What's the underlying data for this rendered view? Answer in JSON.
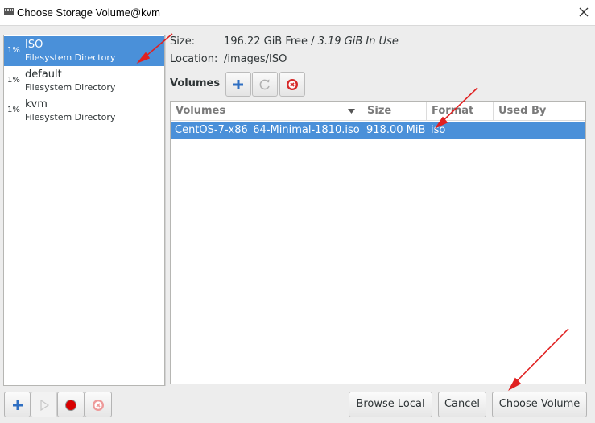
{
  "window": {
    "title": "Choose Storage Volume@kvm"
  },
  "pools": [
    {
      "pct": "1%",
      "name": "ISO",
      "type": "Filesystem Directory",
      "selected": true
    },
    {
      "pct": "1%",
      "name": "default",
      "type": "Filesystem Directory",
      "selected": false
    },
    {
      "pct": "1%",
      "name": "kvm",
      "type": "Filesystem Directory",
      "selected": false
    }
  ],
  "info": {
    "size_label": "Size:",
    "size_free": "196.22 GiB Free / ",
    "size_in_use": "3.19 GiB In Use",
    "location_label": "Location:",
    "location_value": "/images/ISO"
  },
  "volumes": {
    "section_label": "Volumes",
    "columns": [
      "Volumes",
      "Size",
      "Format",
      "Used By"
    ],
    "rows": [
      {
        "name": "CentOS-7-x86_64-Minimal-1810.iso",
        "size": "918.00 MiB",
        "format": "iso",
        "used_by": ""
      }
    ]
  },
  "buttons": {
    "browse_local": "Browse Local",
    "cancel": "Cancel",
    "choose_volume": "Choose Volume"
  },
  "colors": {
    "selection": "#4a90d9",
    "annotation_arrow": "#e02020"
  }
}
